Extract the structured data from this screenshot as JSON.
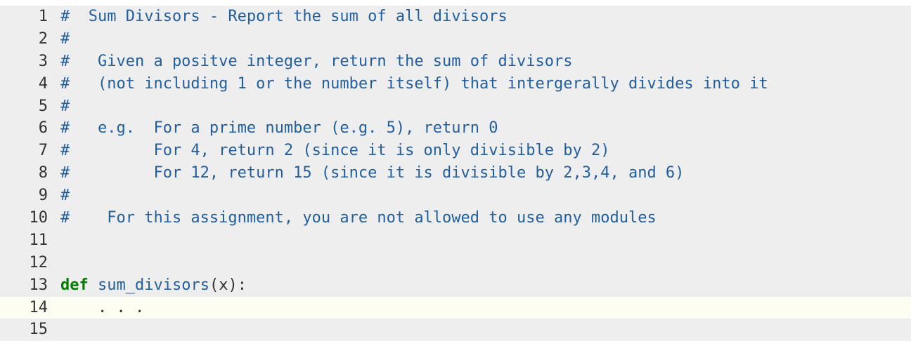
{
  "code": {
    "lines": [
      {
        "num": "1",
        "highlighted": false,
        "tokens": [
          {
            "cls": "tok-comment",
            "t": "#  Sum Divisors - Report the sum of all divisors"
          }
        ]
      },
      {
        "num": "2",
        "highlighted": false,
        "tokens": [
          {
            "cls": "tok-comment",
            "t": "#"
          }
        ]
      },
      {
        "num": "3",
        "highlighted": false,
        "tokens": [
          {
            "cls": "tok-comment",
            "t": "#   Given a positve integer, return the sum of divisors"
          }
        ]
      },
      {
        "num": "4",
        "highlighted": false,
        "tokens": [
          {
            "cls": "tok-comment",
            "t": "#   (not including 1 or the number itself) that intergerally divides into it"
          }
        ]
      },
      {
        "num": "5",
        "highlighted": false,
        "tokens": [
          {
            "cls": "tok-comment",
            "t": "#"
          }
        ]
      },
      {
        "num": "6",
        "highlighted": false,
        "tokens": [
          {
            "cls": "tok-comment",
            "t": "#   e.g.  For a prime number (e.g. 5), return 0"
          }
        ]
      },
      {
        "num": "7",
        "highlighted": false,
        "tokens": [
          {
            "cls": "tok-comment",
            "t": "#         For 4, return 2 (since it is only divisible by 2)"
          }
        ]
      },
      {
        "num": "8",
        "highlighted": false,
        "tokens": [
          {
            "cls": "tok-comment",
            "t": "#         For 12, return 15 (since it is divisible by 2,3,4, and 6)"
          }
        ]
      },
      {
        "num": "9",
        "highlighted": false,
        "tokens": [
          {
            "cls": "tok-comment",
            "t": "#"
          }
        ]
      },
      {
        "num": "10",
        "highlighted": false,
        "tokens": [
          {
            "cls": "tok-comment",
            "t": "#    For this assignment, you are not allowed to use any modules"
          }
        ]
      },
      {
        "num": "11",
        "highlighted": false,
        "tokens": [
          {
            "cls": "tok-plain",
            "t": ""
          }
        ]
      },
      {
        "num": "12",
        "highlighted": false,
        "tokens": [
          {
            "cls": "tok-plain",
            "t": ""
          }
        ]
      },
      {
        "num": "13",
        "highlighted": false,
        "tokens": [
          {
            "cls": "tok-keyword",
            "t": "def"
          },
          {
            "cls": "tok-plain",
            "t": " "
          },
          {
            "cls": "tok-def",
            "t": "sum_divisors"
          },
          {
            "cls": "tok-plain",
            "t": "(x):"
          }
        ]
      },
      {
        "num": "14",
        "highlighted": true,
        "tokens": [
          {
            "cls": "tok-plain",
            "t": "    . . ."
          }
        ]
      },
      {
        "num": "15",
        "highlighted": false,
        "tokens": [
          {
            "cls": "tok-plain",
            "t": ""
          }
        ]
      }
    ]
  }
}
